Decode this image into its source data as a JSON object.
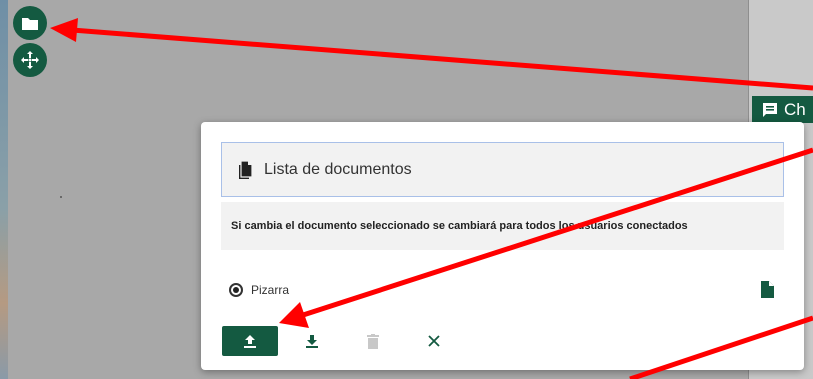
{
  "chat": {
    "label": "Ch"
  },
  "dialog": {
    "title": "Lista de documentos",
    "notice": "Si cambia el documento seleccionado se cambiará para todos los usuarios conectados",
    "documents": [
      {
        "label": "Pizarra",
        "selected": true
      }
    ]
  },
  "colors": {
    "accent": "#145a41",
    "background": "#a8a8a8",
    "annotation_arrow": "#ff0000"
  },
  "icons": [
    "folder-icon",
    "move-icon",
    "chat-icon",
    "document-icon",
    "upload-icon",
    "download-icon",
    "delete-icon",
    "close-icon"
  ]
}
